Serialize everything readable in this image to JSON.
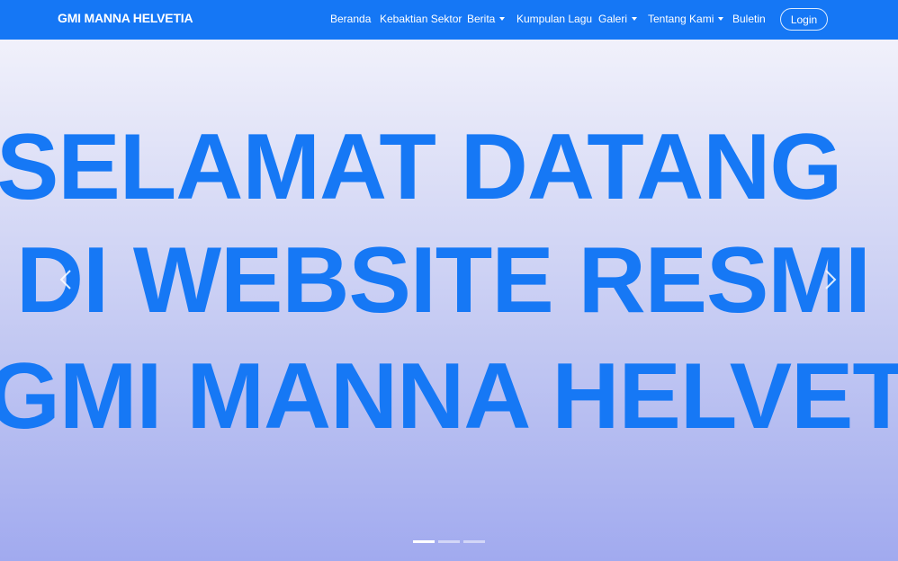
{
  "navbar": {
    "brand": "GMI MANNA HELVETIA",
    "items": [
      {
        "label": "Beranda",
        "dropdown": false
      },
      {
        "label": "Kebaktian Sektor",
        "dropdown": false
      },
      {
        "label": "Berita",
        "dropdown": true
      },
      {
        "label": "Kumpulan Lagu",
        "dropdown": false
      },
      {
        "label": "Galeri",
        "dropdown": true
      },
      {
        "label": "Tentang Kami",
        "dropdown": true
      },
      {
        "label": "Buletin",
        "dropdown": false
      }
    ],
    "login_label": "Login",
    "background_color": "#1577f5"
  },
  "hero": {
    "lines": [
      "SELAMAT DATANG",
      "DI WEBSITE RESMI",
      "GMI MANNA HELVETIA"
    ],
    "text_color": "#1678f5",
    "prev_icon": "chevron-left-icon",
    "next_icon": "chevron-right-icon",
    "slide_count": 3,
    "active_slide": 1
  }
}
